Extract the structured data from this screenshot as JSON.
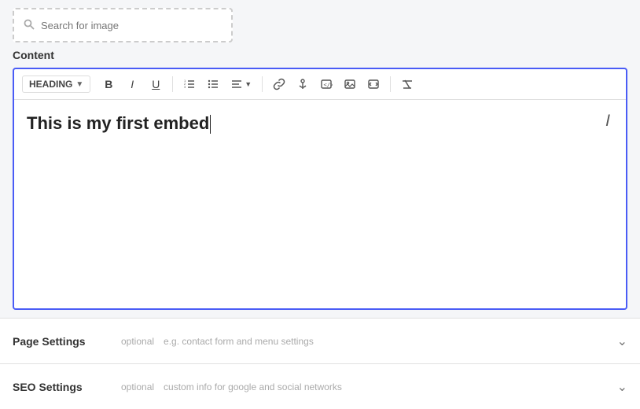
{
  "imageSearch": {
    "placeholder": "Search for image"
  },
  "content": {
    "label": "Content",
    "toolbar": {
      "heading_label": "HEADING",
      "chevron": "▼",
      "bold": "B",
      "italic": "I",
      "underline": "U"
    },
    "editor": {
      "text": "This is my first embed"
    }
  },
  "accordion": [
    {
      "title": "Page Settings",
      "optional": "optional",
      "desc": "e.g. contact form and menu settings"
    },
    {
      "title": "SEO Settings",
      "optional": "optional",
      "desc": "custom info for google and social networks"
    }
  ]
}
